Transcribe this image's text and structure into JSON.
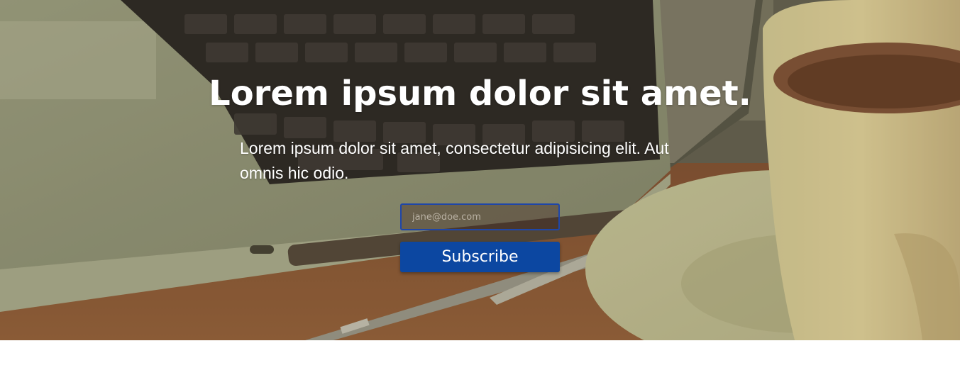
{
  "hero": {
    "headline": "Lorem ipsum dolor sit amet.",
    "subtext": "Lorem ipsum dolor sit amet, consectetur adipisicing elit. Aut omnis hic odio."
  },
  "subscribe_form": {
    "email_placeholder": "jane@doe.com",
    "button_label": "Subscribe"
  },
  "colors": {
    "button_bg": "#0c47a1",
    "input_border": "#1f46a8",
    "text": "#ffffff"
  }
}
